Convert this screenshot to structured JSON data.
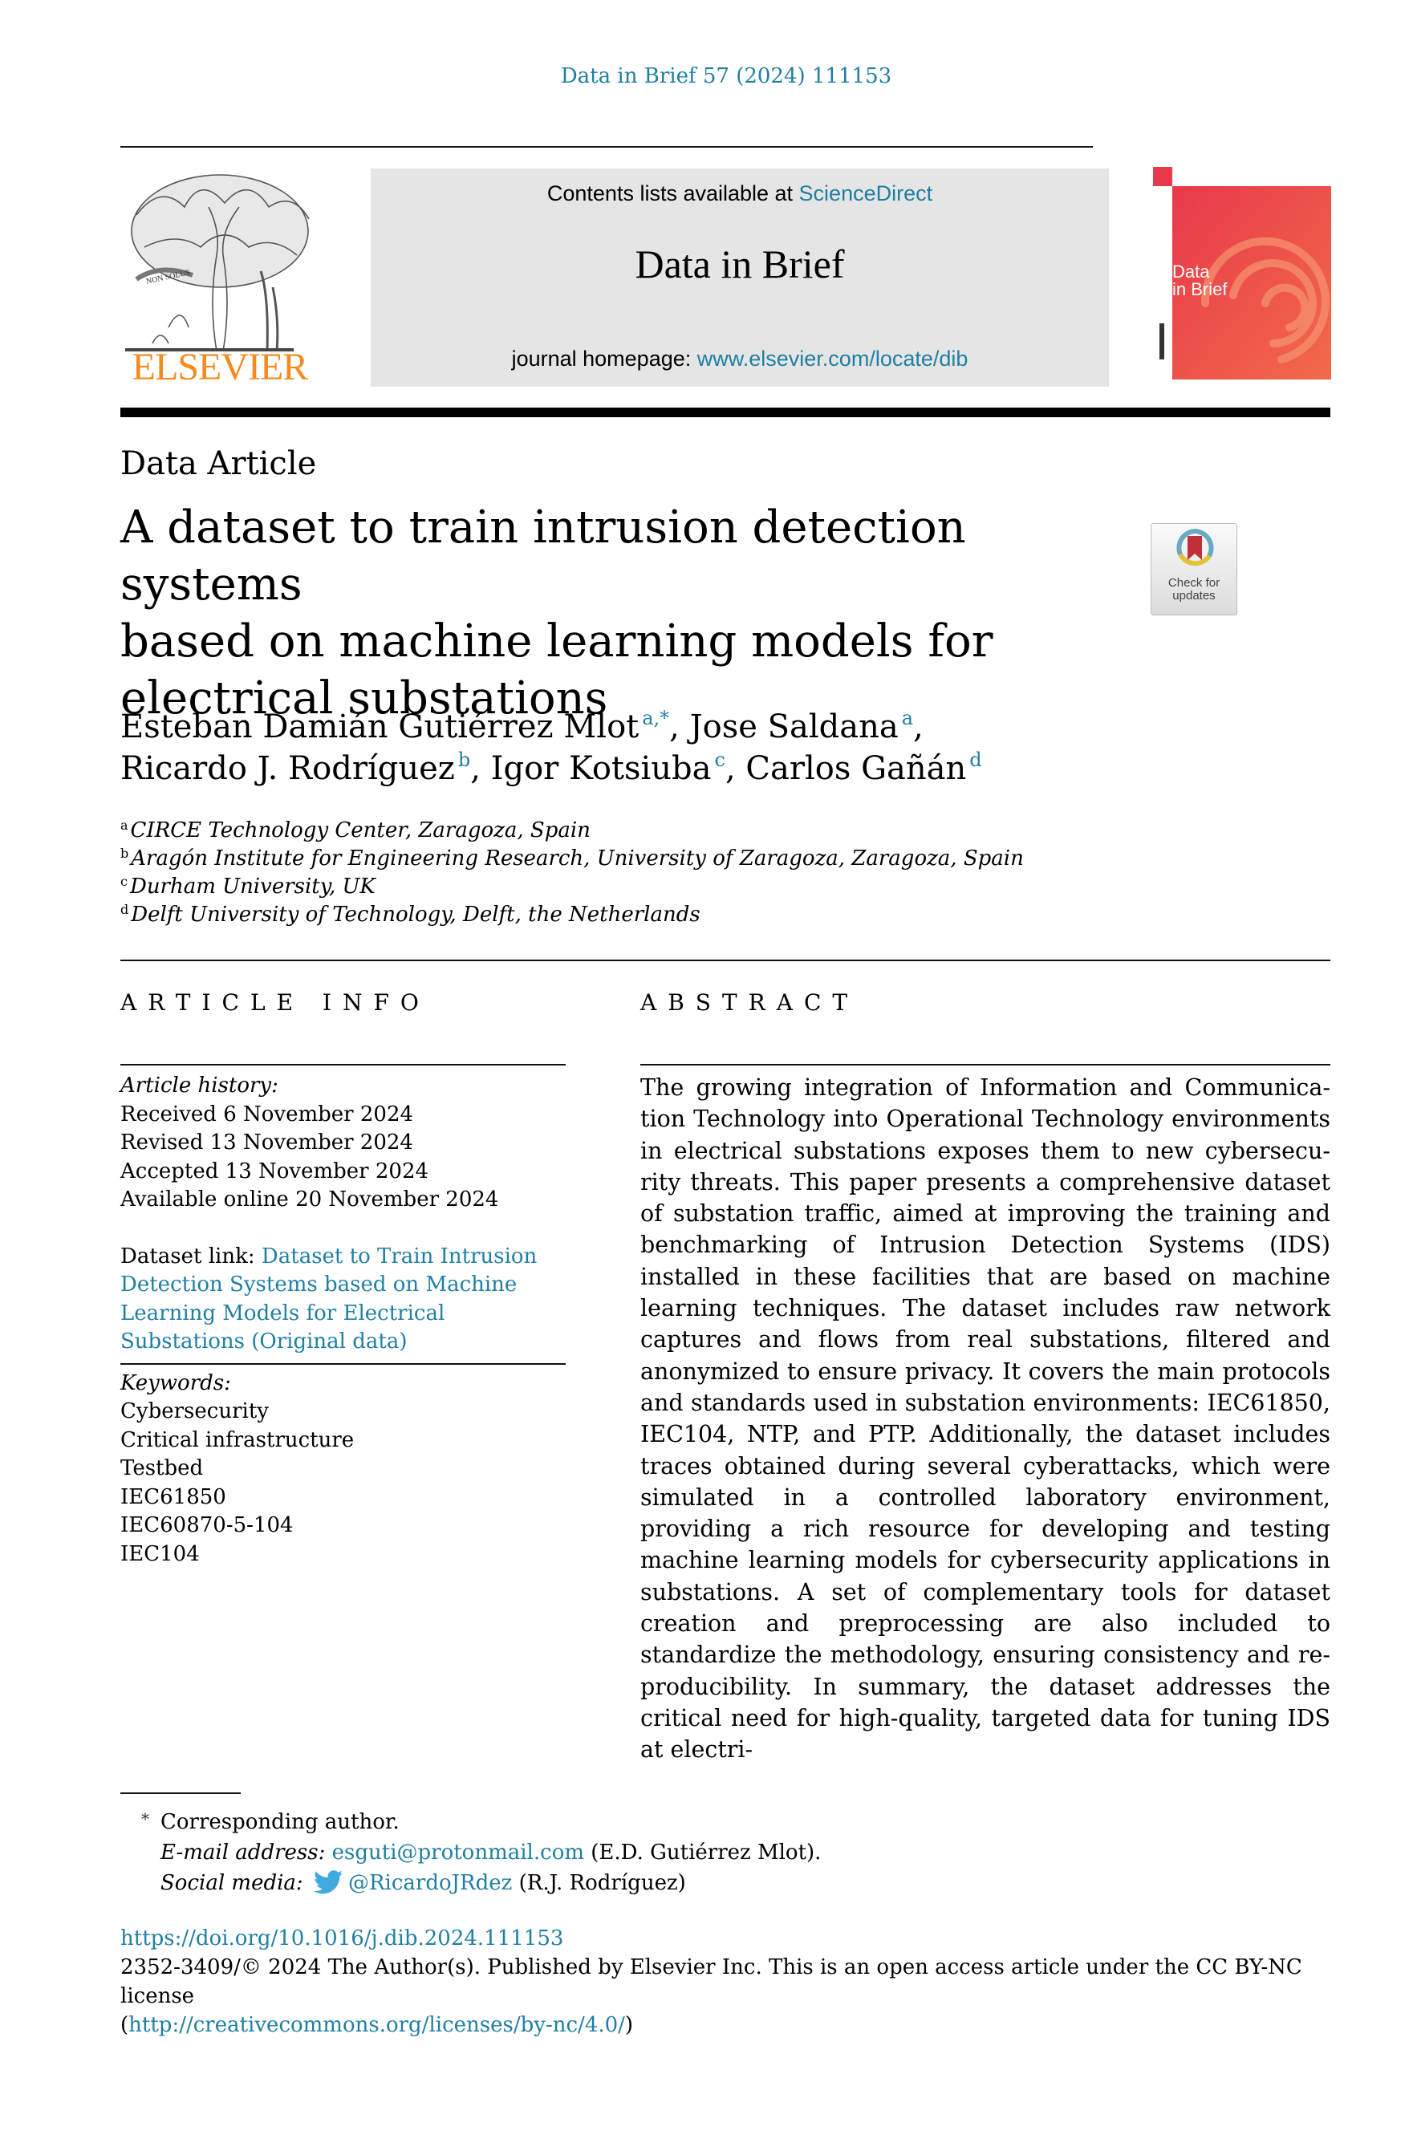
{
  "header": {
    "journal_reference": "Data in Brief 57 (2024) 111153",
    "publisher_logo_text": "ELSEVIER",
    "contents_prefix": "Contents lists available at ",
    "contents_link": "ScienceDirect",
    "journal_title": "Data in Brief",
    "homepage_prefix": "journal homepage: ",
    "homepage_link": "www.elsevier.com/locate/dib",
    "cover_title_line1": "Data",
    "cover_title_line2": "in Brief",
    "cover_brand_color": "#e8394a"
  },
  "article": {
    "type": "Data Article",
    "title_lines": [
      "A dataset to train intrusion detection systems",
      "based on machine learning models for",
      "electrical substations"
    ],
    "check_updates_line1": "Check for",
    "check_updates_line2": "updates",
    "authors": [
      {
        "name": "Esteban Damián Gutiérrez Mlot",
        "marks": "a,*",
        "sep": ", "
      },
      {
        "name": "Jose Saldana",
        "marks": "a",
        "sep": ","
      },
      {
        "name": "Ricardo J. Rodríguez",
        "marks": "b",
        "sep": ", "
      },
      {
        "name": "Igor Kotsiuba",
        "marks": "c",
        "sep": ", "
      },
      {
        "name": "Carlos Gañán",
        "marks": "d",
        "sep": ""
      }
    ],
    "affiliations": [
      {
        "mark": "a",
        "text": "CIRCE Technology Center, Zaragoza, Spain"
      },
      {
        "mark": "b",
        "text": "Aragón Institute for Engineering Research, University of Zaragoza, Zaragoza, Spain"
      },
      {
        "mark": "c",
        "text": "Durham University, UK"
      },
      {
        "mark": "d",
        "text": "Delft University of Technology, Delft, the Netherlands"
      }
    ]
  },
  "article_info": {
    "heading": "ARTICLE INFO",
    "history_label": "Article history:",
    "history": [
      "Received 6 November 2024",
      "Revised 13 November 2024",
      "Accepted 13 November 2024",
      "Available online 20 November 2024"
    ],
    "dataset_label": "Dataset link: ",
    "dataset_link": "Dataset to Train Intrusion Detection Systems based on Machine Learning Models for Electrical Substations (Original data)",
    "keywords_label": "Keywords:",
    "keywords": [
      "Cybersecurity",
      "Critical infrastructure",
      "Testbed",
      "IEC61850",
      "IEC60870-5-104",
      "IEC104"
    ]
  },
  "abstract": {
    "heading": "ABSTRACT",
    "text": "The growing integration of Information and Communica­tion Technology into Operational Technology environments in electrical substations exposes them to new cybersecu­rity threats. This paper presents a comprehensive dataset of substation traffic, aimed at improving the training and benchmarking of Intrusion Detection Systems (IDS) installed in these facilities that are based on machine learning tech­niques. The dataset includes raw network captures and flows from real substations, filtered and anonymized to ensure pri­vacy. It covers the main protocols and standards used in sub­station environments: IEC61850, IEC104, NTP, and PTP. Ad­ditionally, the dataset includes traces obtained during sev­eral cyberattacks, which were simulated in a controlled lab­oratory environment, providing a rich resource for develop­ing and testing machine learning models for cybersecurity applications in substations. A set of complementary tools for dataset creation and preprocessing are also included to standardize the methodology, ensuring consistency and re­producibility. In summary, the dataset addresses the critical need for high-quality, targeted data for tuning IDS at electri-"
  },
  "footnotes": {
    "star": "*",
    "corresponding": "Corresponding author.",
    "email_label": "E-mail address: ",
    "email": "esguti@protonmail.com",
    "email_owner": " (E.D. Gutiérrez Mlot).",
    "social_label": "Social media: ",
    "social_icon": "twitter-icon",
    "social_handle": "@RicardoJRdez",
    "social_owner": " (R.J. Rodríguez)"
  },
  "bottom": {
    "doi": "https://doi.org/10.1016/j.dib.2024.111153",
    "copyright": "2352-3409/© 2024 The Author(s). Published by Elsevier Inc. This is an open access article under the CC BY-NC license",
    "license_open": "(",
    "license_url": "http://creativecommons.org/licenses/by-nc/4.0/",
    "license_close": ")"
  }
}
